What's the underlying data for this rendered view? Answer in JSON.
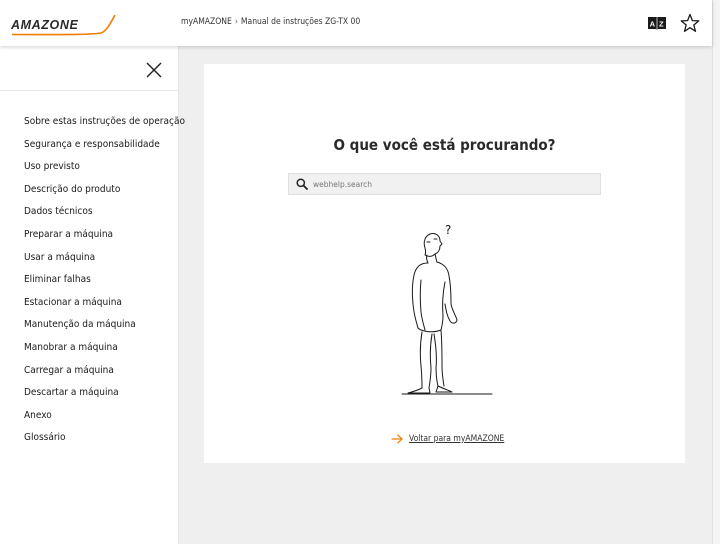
{
  "header": {
    "logo_text": "AMAZONE",
    "breadcrumb": {
      "home": "myAMAZONE",
      "separator": "›",
      "current": "Manual de instruções ZG-TX 00"
    },
    "icons": [
      "language-book-icon",
      "star-icon"
    ]
  },
  "sidebar": {
    "close_icon": "close-icon",
    "items": [
      {
        "label": "Sobre estas instruções de operação"
      },
      {
        "label": "Segurança e responsabilidade"
      },
      {
        "label": "Uso previsto"
      },
      {
        "label": "Descrição do produto"
      },
      {
        "label": "Dados técnicos"
      },
      {
        "label": "Preparar a máquina"
      },
      {
        "label": "Usar a máquina"
      },
      {
        "label": "Eliminar falhas"
      },
      {
        "label": "Estacionar a máquina"
      },
      {
        "label": "Manutenção da máquina"
      },
      {
        "label": "Manobrar a máquina"
      },
      {
        "label": "Carregar a máquina"
      },
      {
        "label": "Descartar a máquina"
      },
      {
        "label": "Anexo"
      },
      {
        "label": "Glossário"
      }
    ]
  },
  "main": {
    "title": "O que você está procurando?",
    "search": {
      "placeholder": "webhelp.search",
      "value": ""
    },
    "back_link": "Voltar para myAMAZONE"
  },
  "colors": {
    "accent": "#f07d00",
    "background": "#efefef",
    "panel": "#ffffff",
    "text": "#222222"
  }
}
